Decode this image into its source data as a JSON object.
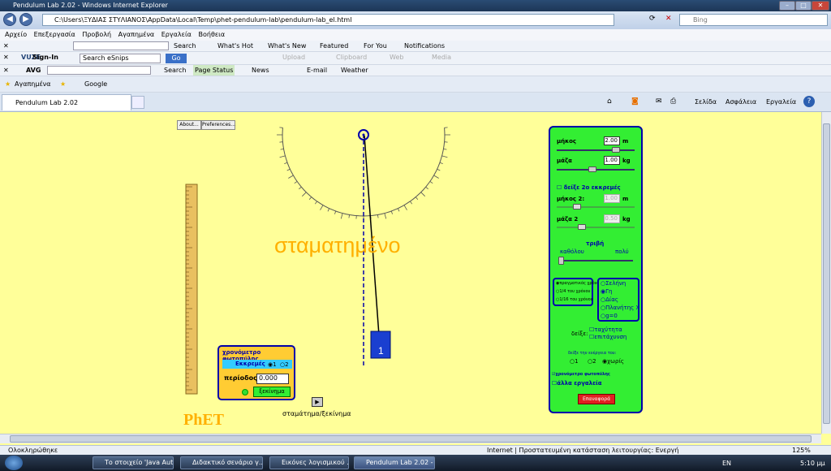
{
  "window": {
    "title": "Pendulum Lab 2.02 - Windows Internet Explorer"
  },
  "address": {
    "url": "C:\\Users\\ΞΥΔΙΑΣ ΣΤΥΛΙΑΝΟΣ\\AppData\\Local\\Temp\\phet-pendulum-lab\\pendulum-lab_el.html",
    "search_placeholder": "Bing"
  },
  "menu": [
    "Αρχείο",
    "Επεξεργασία",
    "Προβολή",
    "Αγαπημένα",
    "Εργαλεία",
    "Βοήθεια"
  ],
  "toolbar1": {
    "search": "Search",
    "whats_hot": "What's Hot",
    "whats_new": "What's New",
    "featured": "Featured",
    "for_you": "For You",
    "notifications": "Notifications"
  },
  "toolbar2": {
    "vuze": "VUZE",
    "signin": "Sign-In",
    "search_value": "Search eSnips",
    "go": "Go",
    "upload": "Upload",
    "clipboard": "Clipboard",
    "web": "Web",
    "media": "Media"
  },
  "toolbar3": {
    "avg": "AVG",
    "search": "Search",
    "page_status": "Page Status",
    "news": "News",
    "email": "E-mail",
    "weather": "Weather"
  },
  "favbar": {
    "favorites": "Αγαπημένα",
    "google": "Google"
  },
  "tab": {
    "label": "Pendulum Lab 2.02"
  },
  "cmdbar": {
    "page": "Σελίδα",
    "safety": "Ασφάλεια",
    "tools": "Εργαλεία"
  },
  "sim": {
    "about": "About...",
    "preferences": "Preferences...",
    "state_text": "σταματημένο",
    "playpause": "σταμάτημα/ξεκίνημα",
    "logo": "PhET",
    "bob_label": "1",
    "controls": {
      "length_label": "μήκος",
      "length_value": "2.00",
      "length_unit": "m",
      "mass_label": "μάζα",
      "mass_value": "1.00",
      "mass_unit": "kg",
      "show2": "δείξε 2ο εκκρεμές",
      "length2_label": "μήκος 2:",
      "length2_value": "1.00",
      "length2_unit": "m",
      "mass2_label": "μάζα 2",
      "mass2_value": "0.50",
      "mass2_unit": "kg",
      "friction": "τριβή",
      "friction_none": "καθόλου",
      "friction_lot": "πολύ",
      "time_options": [
        "πραγματικός χρόνος",
        "1/4 του χρόνου",
        "1/16 του χρόνου"
      ],
      "planets": [
        "Σελήνη",
        "Γη",
        "Δίας",
        "Πλανήτης X",
        "g=0"
      ],
      "show_label": "δείξε:",
      "velocity": "ταχύτητα",
      "acceleration": "επιτάχυνση",
      "energy_label": "δείξε την ενέργεια του:",
      "energy_options": [
        "1",
        "2",
        "χωρίς"
      ],
      "photogate_timer": "χρονόμετρο φωτοπύλης",
      "other_tools": "άλλα εργαλεία",
      "reset": "Επαναφορά"
    },
    "photogate": {
      "title": "χρονόμετρο φωτοπύλης",
      "pendulum_label": "Εκκρεμές",
      "opt1": "1",
      "opt2": "2",
      "period_label": "περίοδος",
      "period_value": "0.000",
      "start": "ξεκίνημα"
    }
  },
  "status": {
    "done": "Ολοκληρώθηκε",
    "zone": "Internet | Προστατευμένη κατάσταση λειτουργίας: Ενεργή",
    "zoom": "125%"
  },
  "taskbar": {
    "items": [
      "Το στοιχείο 'Java Aut...",
      "Διδακτικό σενάριο γ...",
      "Εικόνες λογισμικού ...",
      "Pendulum Lab 2.02 - ..."
    ],
    "lang": "EN",
    "time": "5:10 μμ"
  }
}
